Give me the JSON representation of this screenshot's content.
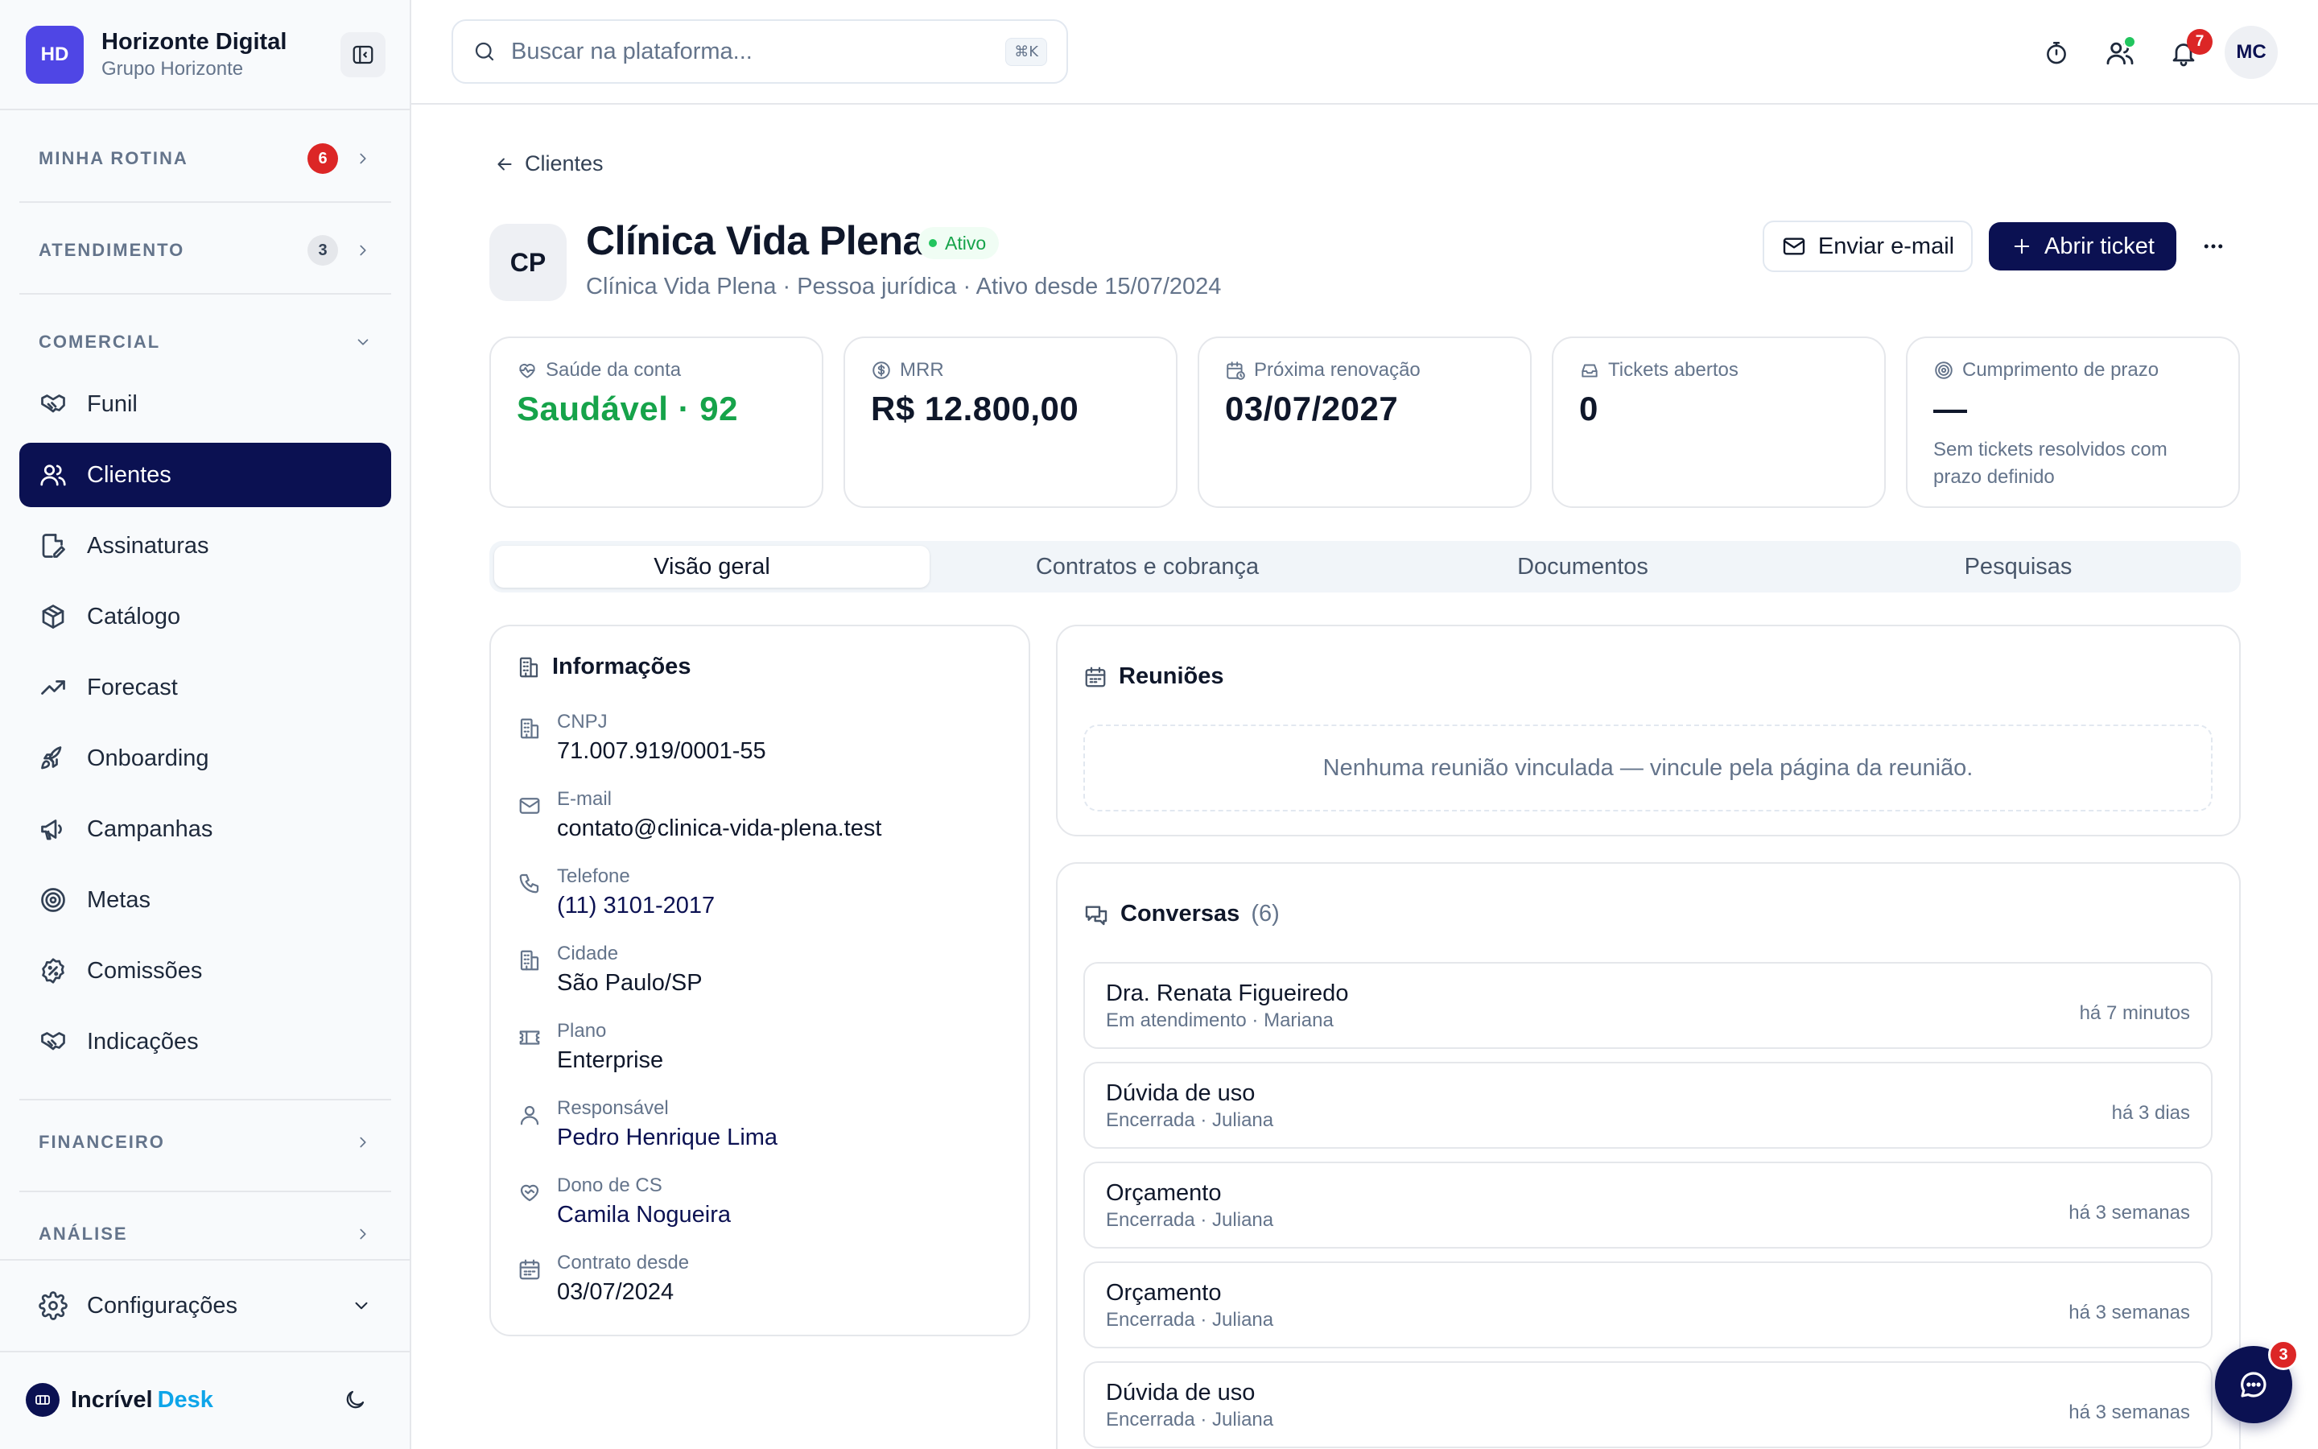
{
  "brand": {
    "initials": "HD",
    "name": "Horizonte Digital",
    "group": "Grupo Horizonte"
  },
  "sidebar": {
    "sections": {
      "rotina": {
        "label": "MINHA ROTINA",
        "count": "6"
      },
      "atendimento": {
        "label": "ATENDIMENTO",
        "count": "3"
      },
      "comercial": {
        "label": "COMERCIAL"
      },
      "financeiro": {
        "label": "FINANCEIRO"
      },
      "analise": {
        "label": "ANÁLISE"
      }
    },
    "items": [
      {
        "label": "Funil",
        "icon": "handshake-icon"
      },
      {
        "label": "Clientes",
        "icon": "users-icon",
        "active": true
      },
      {
        "label": "Assinaturas",
        "icon": "file-signature-icon"
      },
      {
        "label": "Catálogo",
        "icon": "package-icon"
      },
      {
        "label": "Forecast",
        "icon": "trending-up-icon"
      },
      {
        "label": "Onboarding",
        "icon": "rocket-icon"
      },
      {
        "label": "Campanhas",
        "icon": "megaphone-icon"
      },
      {
        "label": "Metas",
        "icon": "target-icon"
      },
      {
        "label": "Comissões",
        "icon": "percent-badge-icon"
      },
      {
        "label": "Indicações",
        "icon": "handshake-icon"
      }
    ],
    "settings": "Configurações",
    "footer": {
      "logo_a": "Incrível",
      "logo_b": "Desk"
    }
  },
  "topbar": {
    "search_placeholder": "Buscar na plataforma...",
    "shortcut": "⌘K",
    "notifications_count": "7",
    "user_initials": "MC"
  },
  "client": {
    "back_label": "Clientes",
    "initials": "CP",
    "name": "Clínica Vida Plena",
    "status": "Ativo",
    "meta": "Clínica Vida Plena · Pessoa jurídica · Ativo desde 15/07/2024",
    "actions": {
      "email": "Enviar e-mail",
      "ticket": "Abrir ticket"
    }
  },
  "kpis": [
    {
      "label": "Saúde da conta",
      "value": "Saudável · 92",
      "icon": "heart-pulse-icon"
    },
    {
      "label": "MRR",
      "value": "R$ 12.800,00",
      "icon": "dollar-circle-icon"
    },
    {
      "label": "Próxima renovação",
      "value": "03/07/2027",
      "icon": "calendar-clock-icon"
    },
    {
      "label": "Tickets abertos",
      "value": "0",
      "icon": "inbox-icon"
    },
    {
      "label": "Cumprimento de prazo",
      "value": "—",
      "note": "Sem tickets resolvidos com prazo definido",
      "icon": "target-icon"
    }
  ],
  "tabs": [
    "Visão geral",
    "Contratos e cobrança",
    "Documentos",
    "Pesquisas"
  ],
  "info": {
    "title": "Informações",
    "rows": [
      {
        "label": "CNPJ",
        "value": "71.007.919/0001-55",
        "icon": "building-icon"
      },
      {
        "label": "E-mail",
        "value": "contato@clinica-vida-plena.test",
        "icon": "mail-icon"
      },
      {
        "label": "Telefone",
        "value": "(11) 3101-2017",
        "icon": "phone-icon"
      },
      {
        "label": "Cidade",
        "value": "São Paulo/SP",
        "icon": "building-icon"
      },
      {
        "label": "Plano",
        "value": "Enterprise",
        "icon": "ticket-icon"
      },
      {
        "label": "Responsável",
        "value": "Pedro Henrique Lima",
        "icon": "user-icon"
      },
      {
        "label": "Dono de CS",
        "value": "Camila Nogueira",
        "icon": "heart-handshake-icon"
      },
      {
        "label": "Contrato desde",
        "value": "03/07/2024",
        "icon": "calendar-icon"
      }
    ]
  },
  "meetings": {
    "title": "Reuniões",
    "empty": "Nenhuma reunião vinculada — vincule pela página da reunião."
  },
  "conversations": {
    "title": "Conversas",
    "count": "(6)",
    "items": [
      {
        "title": "Dra. Renata Figueiredo",
        "sub": "Em atendimento · Mariana",
        "time": "há 7 minutos"
      },
      {
        "title": "Dúvida de uso",
        "sub": "Encerrada · Juliana",
        "time": "há 3 dias"
      },
      {
        "title": "Orçamento",
        "sub": "Encerrada · Juliana",
        "time": "há 3 semanas"
      },
      {
        "title": "Orçamento",
        "sub": "Encerrada · Juliana",
        "time": "há 3 semanas"
      },
      {
        "title": "Dúvida de uso",
        "sub": "Encerrada · Juliana",
        "time": "há 3 semanas"
      }
    ]
  },
  "chat": {
    "badge": "3"
  },
  "colors": {
    "primary": "#0b1152",
    "brand": "#4f46e5",
    "success": "#16a34a",
    "danger": "#dc2626",
    "accent": "#0ea5e9"
  }
}
